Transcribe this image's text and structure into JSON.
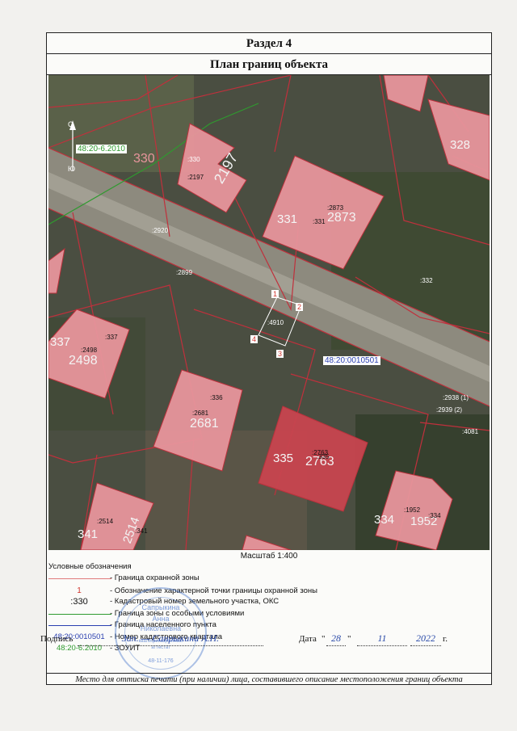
{
  "section_title": "Раздел 4",
  "plan_title": "План границ объекта",
  "compass": {
    "north": "С",
    "south": "Ю"
  },
  "map": {
    "zone_label": "48:20-6.2010",
    "quarter_label": "48:20:0010501",
    "parcels": [
      {
        "id": "330",
        "label": "330"
      },
      {
        "id": "331",
        "label": "331"
      },
      {
        "id": "328",
        "label": "328"
      },
      {
        "id": "337",
        "label": "337"
      },
      {
        "id": "335",
        "label": "335"
      },
      {
        "id": "334",
        "label": "334"
      },
      {
        "id": "341",
        "label": "341"
      }
    ],
    "buildings": [
      {
        "id": "2197",
        "label": "2197",
        "small": ":2197"
      },
      {
        "id": "2873",
        "label": "2873",
        "small": ":2873"
      },
      {
        "id": "2498",
        "label": "2498",
        "small": ":2498"
      },
      {
        "id": "2681",
        "label": "2681",
        "small": ":2681"
      },
      {
        "id": "2763",
        "label": "2763",
        "small": ":2763"
      },
      {
        "id": "1952",
        "label": "1952",
        "small": ":1952"
      },
      {
        "id": "2514",
        "label": "2514",
        "small": ":2514"
      }
    ],
    "small_labels": {
      "s330": ":330",
      "s331": ":331",
      "s337": ":337",
      "s336": ":336",
      "s335": ":335",
      "s334": ":334",
      "s341": ":341",
      "s332": ":332",
      "s2920": ":2920",
      "s2899": ":2899",
      "s4910": ":4910",
      "s2938": ":2938 (1)",
      "s2939": ":2939 (2)",
      "s4081": ":4081"
    },
    "points": [
      "1",
      "2",
      "3",
      "4"
    ]
  },
  "scale": "Масштаб 1:400",
  "legend": {
    "title": "Условные обозначения",
    "items": [
      {
        "symbol": "",
        "text": "- Граница охранной зоны"
      },
      {
        "symbol": "1",
        "text": "- Обозначение характерной точки границы охранной зоны"
      },
      {
        "symbol": ":330",
        "text": "- Кадастровый номер земельного участка, ОКС"
      },
      {
        "symbol": "",
        "text": "- Граница зоны с особыми условиями"
      },
      {
        "symbol": "",
        "text": "- Граница населенного пункта"
      },
      {
        "symbol": "48:20:0010501",
        "text": "- Номер кадастрового квартала"
      },
      {
        "symbol": "48:20-6.2010",
        "text": "- ЗОУИТ"
      }
    ],
    "colors": {
      "protect_zone": "#e07a7a",
      "point": "#d0342c",
      "special_zone": "#2f9a2f",
      "settlement": "#2a3fb0",
      "quarter": "#2a3fb0",
      "zouit": "#2f9a2f"
    }
  },
  "stamp": {
    "line1": "Сапрыкина",
    "line2": "Анна",
    "line3": "Николаевна",
    "outer1": "квалификационный",
    "outer2": "аттестат",
    "number": "48-11-176"
  },
  "signature": {
    "label": "Подпись",
    "handwriting": "Зап. — Сапрыкина А.Н.",
    "date_label": "Дата",
    "day": "28",
    "month": "11",
    "year": "2022",
    "year_suffix": "г."
  },
  "footer": "Место для оттиска печати (при наличии) лица, составившего описание местоположения границ объекта"
}
